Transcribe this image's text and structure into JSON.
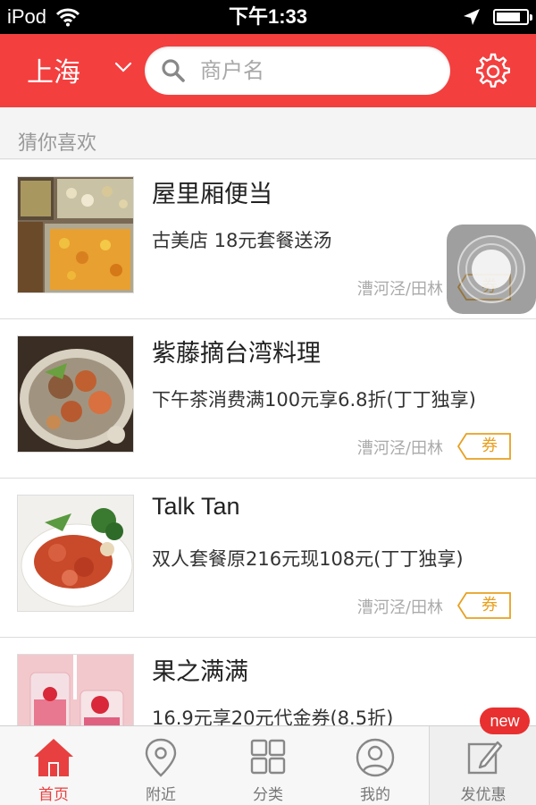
{
  "status_bar": {
    "carrier": "iPod",
    "time": "下午1:33",
    "battery_level": 0.8
  },
  "header": {
    "city": "上海",
    "search_placeholder": "商户名",
    "icons": {
      "city_dropdown": "chevron-down-icon",
      "search": "search-icon",
      "settings": "gear-icon"
    },
    "accent_color": "#f43f3f"
  },
  "section": {
    "title": "猜你喜欢"
  },
  "items": [
    {
      "title": "屋里厢便当",
      "desc": "古美店 18元套餐送汤",
      "location": "漕河泾/田林",
      "coupon": "券"
    },
    {
      "title": "紫藤摘台湾料理",
      "desc": "下午茶消费满100元享6.8折(丁丁独享)",
      "location": "漕河泾/田林",
      "coupon": "券"
    },
    {
      "title": "Talk Tan",
      "desc": "双人套餐原216元现108元(丁丁独享)",
      "location": "漕河泾/田林",
      "coupon": "券"
    },
    {
      "title": "果之满满",
      "desc": "16.9元享20元代金券(8.5折)",
      "location": "",
      "coupon": ""
    }
  ],
  "tabbar": {
    "tabs": [
      {
        "label": "首页",
        "icon": "home-icon",
        "active": true
      },
      {
        "label": "附近",
        "icon": "location-pin-icon",
        "active": false
      },
      {
        "label": "分类",
        "icon": "grid-icon",
        "active": false
      },
      {
        "label": "我的",
        "icon": "user-icon",
        "active": false
      },
      {
        "label": "发优惠",
        "icon": "edit-icon",
        "active": false
      }
    ],
    "badge": "new",
    "active_color": "#e84040"
  }
}
